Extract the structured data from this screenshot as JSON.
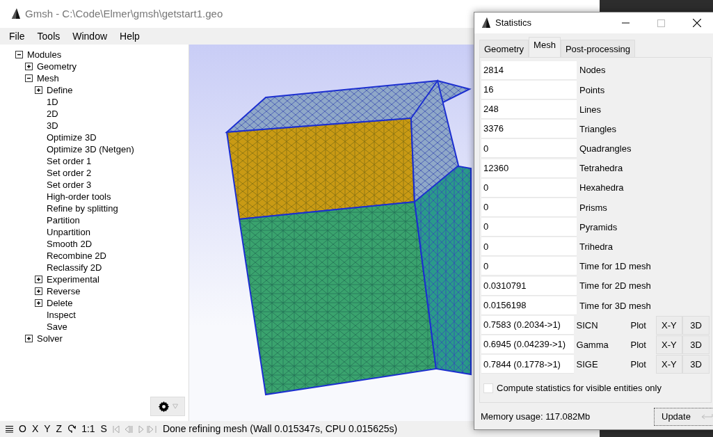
{
  "window": {
    "title": "Gmsh - C:\\Code\\Elmer\\gmsh\\getstart1.geo"
  },
  "menu": [
    "File",
    "Tools",
    "Window",
    "Help"
  ],
  "tree": [
    {
      "label": "Modules",
      "kind": "folder",
      "expanded": true,
      "children": [
        {
          "label": "Geometry",
          "kind": "folder",
          "expanded": false
        },
        {
          "label": "Mesh",
          "kind": "folder",
          "expanded": true,
          "children": [
            {
              "label": "Define",
              "kind": "folder",
              "expanded": false
            },
            {
              "label": "1D",
              "kind": "leaf"
            },
            {
              "label": "2D",
              "kind": "leaf"
            },
            {
              "label": "3D",
              "kind": "leaf"
            },
            {
              "label": "Optimize 3D",
              "kind": "leaf"
            },
            {
              "label": "Optimize 3D (Netgen)",
              "kind": "leaf"
            },
            {
              "label": "Set order 1",
              "kind": "leaf"
            },
            {
              "label": "Set order 2",
              "kind": "leaf"
            },
            {
              "label": "Set order 3",
              "kind": "leaf"
            },
            {
              "label": "High-order tools",
              "kind": "leaf"
            },
            {
              "label": "Refine by splitting",
              "kind": "leaf"
            },
            {
              "label": "Partition",
              "kind": "leaf"
            },
            {
              "label": "Unpartition",
              "kind": "leaf"
            },
            {
              "label": "Smooth 2D",
              "kind": "leaf"
            },
            {
              "label": "Recombine 2D",
              "kind": "leaf"
            },
            {
              "label": "Reclassify 2D",
              "kind": "leaf"
            },
            {
              "label": "Experimental",
              "kind": "folder",
              "expanded": false
            },
            {
              "label": "Reverse",
              "kind": "folder",
              "expanded": false
            },
            {
              "label": "Delete",
              "kind": "folder",
              "expanded": false
            },
            {
              "label": "Inspect",
              "kind": "leaf"
            },
            {
              "label": "Save",
              "kind": "leaf"
            }
          ]
        },
        {
          "label": "Solver",
          "kind": "folder",
          "expanded": false
        }
      ]
    }
  ],
  "status_bar": {
    "axis_buttons": [
      "O",
      "X",
      "Y",
      "Z"
    ],
    "scale": "1:1",
    "s_button": "S",
    "message": "Done refining mesh (Wall 0.015347s, CPU 0.015625s)"
  },
  "dialog": {
    "title": "Statistics",
    "tabs": [
      {
        "label": "Geometry",
        "selected": false
      },
      {
        "label": "Mesh",
        "selected": true
      },
      {
        "label": "Post-processing",
        "selected": false
      }
    ],
    "rows": [
      {
        "value": "2814",
        "label": "Nodes",
        "kind": "plain"
      },
      {
        "value": "16",
        "label": "Points",
        "kind": "plain"
      },
      {
        "value": "248",
        "label": "Lines",
        "kind": "plain"
      },
      {
        "value": "3376",
        "label": "Triangles",
        "kind": "plain"
      },
      {
        "value": "0",
        "label": "Quadrangles",
        "kind": "plain"
      },
      {
        "value": "12360",
        "label": "Tetrahedra",
        "kind": "plain"
      },
      {
        "value": "0",
        "label": "Hexahedra",
        "kind": "plain"
      },
      {
        "value": "0",
        "label": "Prisms",
        "kind": "plain"
      },
      {
        "value": "0",
        "label": "Pyramids",
        "kind": "plain"
      },
      {
        "value": "0",
        "label": "Trihedra",
        "kind": "plain"
      },
      {
        "value": "0",
        "label": "Time for 1D mesh",
        "kind": "plain"
      },
      {
        "value": "0.0310791",
        "label": "Time for 2D mesh",
        "kind": "plain"
      },
      {
        "value": "0.0156198",
        "label": "Time for 3D mesh",
        "kind": "plain"
      },
      {
        "value": "0.7583 (0.2034->1)",
        "label": "SICN",
        "kind": "quality",
        "plot": "Plot",
        "buttons": [
          "X-Y",
          "3D"
        ]
      },
      {
        "value": "0.6945 (0.04239->1)",
        "label": "Gamma",
        "kind": "quality",
        "plot": "Plot",
        "buttons": [
          "X-Y",
          "3D"
        ]
      },
      {
        "value": "0.7844 (0.1778->1)",
        "label": "SIGE",
        "kind": "quality",
        "plot": "Plot",
        "buttons": [
          "X-Y",
          "3D"
        ]
      }
    ],
    "checkbox": {
      "label": "Compute statistics for visible entities only",
      "checked": false
    },
    "memory": "Memory usage: 117.082Mb",
    "update_button": "Update"
  }
}
